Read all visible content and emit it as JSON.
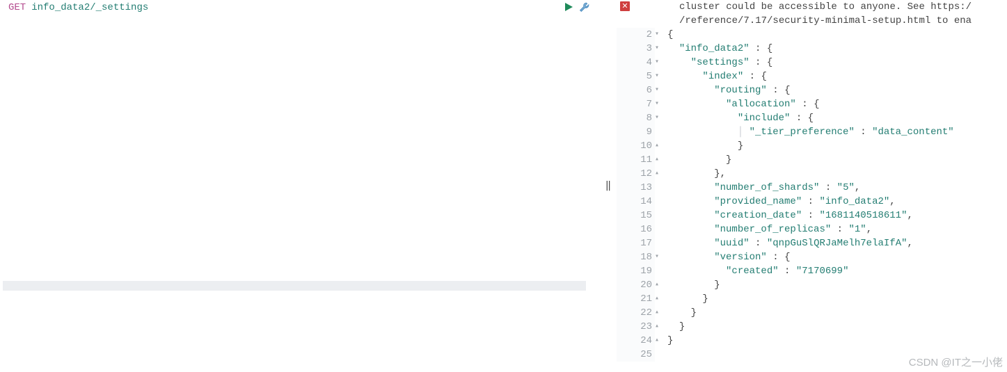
{
  "request": {
    "method": "GET",
    "path": "info_data2/_settings"
  },
  "actions": {
    "run_tooltip": "Run",
    "tools_tooltip": "Options"
  },
  "splitter_glyph": "‖",
  "response": {
    "warning_line1": "cluster could be accessible to anyone. See https:/",
    "warning_line2": "/reference/7.17/security-minimal-setup.html to ena",
    "error_badge": "✕",
    "lines": [
      {
        "n": 2,
        "fold": "▾",
        "indent": "",
        "content": [
          [
            "brace",
            "{"
          ]
        ]
      },
      {
        "n": 3,
        "fold": "▾",
        "indent": "  ",
        "content": [
          [
            "key",
            "\"info_data2\""
          ],
          [
            "punct",
            " : "
          ],
          [
            "brace",
            "{"
          ]
        ]
      },
      {
        "n": 4,
        "fold": "▾",
        "indent": "    ",
        "content": [
          [
            "key",
            "\"settings\""
          ],
          [
            "punct",
            " : "
          ],
          [
            "brace",
            "{"
          ]
        ]
      },
      {
        "n": 5,
        "fold": "▾",
        "indent": "      ",
        "content": [
          [
            "key",
            "\"index\""
          ],
          [
            "punct",
            " : "
          ],
          [
            "brace",
            "{"
          ]
        ]
      },
      {
        "n": 6,
        "fold": "▾",
        "indent": "        ",
        "content": [
          [
            "key",
            "\"routing\""
          ],
          [
            "punct",
            " : "
          ],
          [
            "brace",
            "{"
          ]
        ]
      },
      {
        "n": 7,
        "fold": "▾",
        "indent": "          ",
        "content": [
          [
            "key",
            "\"allocation\""
          ],
          [
            "punct",
            " : "
          ],
          [
            "brace",
            "{"
          ]
        ]
      },
      {
        "n": 8,
        "fold": "▾",
        "indent": "            ",
        "content": [
          [
            "key",
            "\"include\""
          ],
          [
            "punct",
            " : "
          ],
          [
            "brace",
            "{"
          ]
        ]
      },
      {
        "n": 9,
        "fold": "",
        "indent": "            | ",
        "content": [
          [
            "key",
            "\"_tier_preference\""
          ],
          [
            "punct",
            " : "
          ],
          [
            "str",
            "\"data_content\""
          ]
        ]
      },
      {
        "n": 10,
        "fold": "▴",
        "indent": "            ",
        "content": [
          [
            "brace",
            "}"
          ]
        ]
      },
      {
        "n": 11,
        "fold": "▴",
        "indent": "          ",
        "content": [
          [
            "brace",
            "}"
          ]
        ]
      },
      {
        "n": 12,
        "fold": "▴",
        "indent": "        ",
        "content": [
          [
            "brace",
            "}"
          ],
          [
            "punct",
            ","
          ]
        ]
      },
      {
        "n": 13,
        "fold": "",
        "indent": "        ",
        "content": [
          [
            "key",
            "\"number_of_shards\""
          ],
          [
            "punct",
            " : "
          ],
          [
            "str",
            "\"5\""
          ],
          [
            "punct",
            ","
          ]
        ]
      },
      {
        "n": 14,
        "fold": "",
        "indent": "        ",
        "content": [
          [
            "key",
            "\"provided_name\""
          ],
          [
            "punct",
            " : "
          ],
          [
            "str",
            "\"info_data2\""
          ],
          [
            "punct",
            ","
          ]
        ]
      },
      {
        "n": 15,
        "fold": "",
        "indent": "        ",
        "content": [
          [
            "key",
            "\"creation_date\""
          ],
          [
            "punct",
            " : "
          ],
          [
            "str",
            "\"1681140518611\""
          ],
          [
            "punct",
            ","
          ]
        ]
      },
      {
        "n": 16,
        "fold": "",
        "indent": "        ",
        "content": [
          [
            "key",
            "\"number_of_replicas\""
          ],
          [
            "punct",
            " : "
          ],
          [
            "str",
            "\"1\""
          ],
          [
            "punct",
            ","
          ]
        ]
      },
      {
        "n": 17,
        "fold": "",
        "indent": "        ",
        "content": [
          [
            "key",
            "\"uuid\""
          ],
          [
            "punct",
            " : "
          ],
          [
            "str",
            "\"qnpGuSlQRJaMelh7elaIfA\""
          ],
          [
            "punct",
            ","
          ]
        ]
      },
      {
        "n": 18,
        "fold": "▾",
        "indent": "        ",
        "content": [
          [
            "key",
            "\"version\""
          ],
          [
            "punct",
            " : "
          ],
          [
            "brace",
            "{"
          ]
        ]
      },
      {
        "n": 19,
        "fold": "",
        "indent": "          ",
        "content": [
          [
            "key",
            "\"created\""
          ],
          [
            "punct",
            " : "
          ],
          [
            "str",
            "\"7170699\""
          ]
        ]
      },
      {
        "n": 20,
        "fold": "▴",
        "indent": "        ",
        "content": [
          [
            "brace",
            "}"
          ]
        ]
      },
      {
        "n": 21,
        "fold": "▴",
        "indent": "      ",
        "content": [
          [
            "brace",
            "}"
          ]
        ]
      },
      {
        "n": 22,
        "fold": "▴",
        "indent": "    ",
        "content": [
          [
            "brace",
            "}"
          ]
        ]
      },
      {
        "n": 23,
        "fold": "▴",
        "indent": "  ",
        "content": [
          [
            "brace",
            "}"
          ]
        ]
      },
      {
        "n": 24,
        "fold": "▴",
        "indent": "",
        "content": [
          [
            "brace",
            "}"
          ]
        ]
      },
      {
        "n": 25,
        "fold": "",
        "indent": "",
        "content": []
      }
    ]
  },
  "watermark": "CSDN @IT之一小佬"
}
